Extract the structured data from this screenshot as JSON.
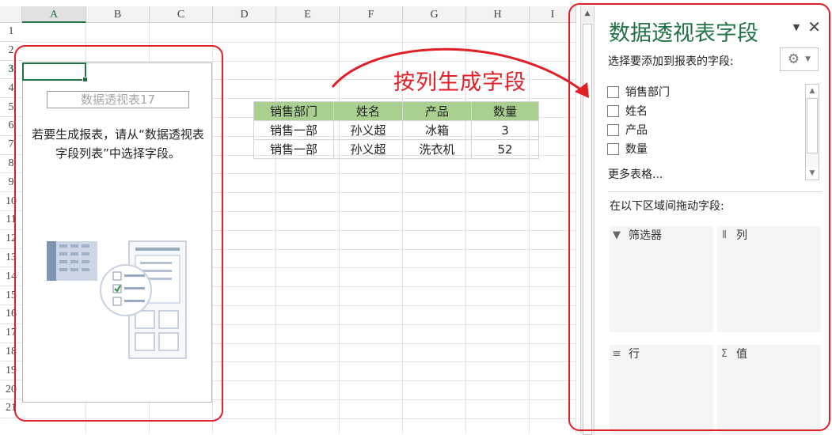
{
  "sheet": {
    "columns": [
      "A",
      "B",
      "C",
      "D",
      "E",
      "F",
      "G",
      "H",
      "I"
    ],
    "rows": [
      "1",
      "2",
      "3",
      "4",
      "5",
      "6",
      "7",
      "8",
      "9",
      "10",
      "11",
      "12",
      "13",
      "14",
      "15",
      "16",
      "17",
      "18",
      "19",
      "20",
      "21"
    ],
    "selected_column": "A",
    "selected_row": "3"
  },
  "pivot": {
    "name": "数据透视表17",
    "hint": "若要生成报表，请从“数据透视表字段列表”中选择字段。"
  },
  "table": {
    "headers": [
      "销售部门",
      "姓名",
      "产品",
      "数量"
    ],
    "rows": [
      [
        "销售一部",
        "孙义超",
        "冰箱",
        "3"
      ],
      [
        "销售一部",
        "孙义超",
        "洗衣机",
        "52"
      ]
    ]
  },
  "annotation": {
    "text": "按列生成字段",
    "color": "#e01f27"
  },
  "panel": {
    "title": "数据透视表字段",
    "subtitle": "选择要添加到报表的字段:",
    "fields": [
      "销售部门",
      "姓名",
      "产品",
      "数量"
    ],
    "more_tables": "更多表格...",
    "drag_hint": "在以下区域间拖动字段:",
    "areas": {
      "filter": "筛选器",
      "columns": "列",
      "rows": "行",
      "values": "值"
    },
    "accent": "#217346"
  }
}
